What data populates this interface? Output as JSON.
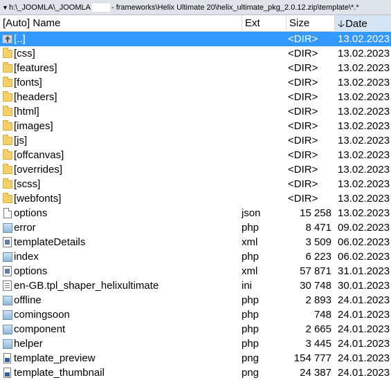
{
  "path_bar": {
    "prefix": "h:\\_JOOMLA\\_JOOMLA",
    "suffix": "- frameworks\\Helix Ultimate 20\\helix_ultimate_pkg_2.0.12.zip\\template\\*.*"
  },
  "columns": {
    "name": "[Auto] Name",
    "ext": "Ext",
    "size": "Size",
    "date": "Date"
  },
  "sort": {
    "column": "date",
    "direction": "descending",
    "arrow": "🡣"
  },
  "colors": {
    "selection": "#3399ff",
    "header_active": "#d6e5f5",
    "folder": "#f5d06a"
  },
  "files": [
    {
      "name": "[..]",
      "ext": "",
      "size": "<DIR>",
      "date": "13.02.2023",
      "icon": "up-icon",
      "selected": true
    },
    {
      "name": "[css]",
      "ext": "",
      "size": "<DIR>",
      "date": "13.02.2023",
      "icon": "folder-icon"
    },
    {
      "name": "[features]",
      "ext": "",
      "size": "<DIR>",
      "date": "13.02.2023",
      "icon": "folder-icon"
    },
    {
      "name": "[fonts]",
      "ext": "",
      "size": "<DIR>",
      "date": "13.02.2023",
      "icon": "folder-icon"
    },
    {
      "name": "[headers]",
      "ext": "",
      "size": "<DIR>",
      "date": "13.02.2023",
      "icon": "folder-icon"
    },
    {
      "name": "[html]",
      "ext": "",
      "size": "<DIR>",
      "date": "13.02.2023",
      "icon": "folder-icon"
    },
    {
      "name": "[images]",
      "ext": "",
      "size": "<DIR>",
      "date": "13.02.2023",
      "icon": "folder-icon"
    },
    {
      "name": "[js]",
      "ext": "",
      "size": "<DIR>",
      "date": "13.02.2023",
      "icon": "folder-icon"
    },
    {
      "name": "[offcanvas]",
      "ext": "",
      "size": "<DIR>",
      "date": "13.02.2023",
      "icon": "folder-icon"
    },
    {
      "name": "[overrides]",
      "ext": "",
      "size": "<DIR>",
      "date": "13.02.2023",
      "icon": "folder-icon"
    },
    {
      "name": "[scss]",
      "ext": "",
      "size": "<DIR>",
      "date": "13.02.2023",
      "icon": "folder-icon"
    },
    {
      "name": "[webfonts]",
      "ext": "",
      "size": "<DIR>",
      "date": "13.02.2023",
      "icon": "folder-icon"
    },
    {
      "name": "options",
      "ext": "json",
      "size": "15 258",
      "date": "13.02.2023",
      "icon": "document-icon"
    },
    {
      "name": "error",
      "ext": "php",
      "size": "8 471",
      "date": "09.02.2023",
      "icon": "php-file-icon"
    },
    {
      "name": "templateDetails",
      "ext": "xml",
      "size": "3 509",
      "date": "06.02.2023",
      "icon": "xml-file-icon"
    },
    {
      "name": "index",
      "ext": "php",
      "size": "6 223",
      "date": "06.02.2023",
      "icon": "php-file-icon"
    },
    {
      "name": "options",
      "ext": "xml",
      "size": "57 871",
      "date": "31.01.2023",
      "icon": "xml-file-icon"
    },
    {
      "name": "en-GB.tpl_shaper_helixultimate",
      "ext": "ini",
      "size": "30 748",
      "date": "30.01.2023",
      "icon": "ini-file-icon"
    },
    {
      "name": "offline",
      "ext": "php",
      "size": "2 893",
      "date": "24.01.2023",
      "icon": "php-file-icon"
    },
    {
      "name": "comingsoon",
      "ext": "php",
      "size": "748",
      "date": "24.01.2023",
      "icon": "php-file-icon"
    },
    {
      "name": "component",
      "ext": "php",
      "size": "2 665",
      "date": "24.01.2023",
      "icon": "php-file-icon"
    },
    {
      "name": "helper",
      "ext": "php",
      "size": "3 445",
      "date": "24.01.2023",
      "icon": "php-file-icon"
    },
    {
      "name": "template_preview",
      "ext": "png",
      "size": "154 777",
      "date": "24.01.2023",
      "icon": "png-file-icon"
    },
    {
      "name": "template_thumbnail",
      "ext": "png",
      "size": "24 387",
      "date": "24.01.2023",
      "icon": "png-file-icon"
    }
  ]
}
